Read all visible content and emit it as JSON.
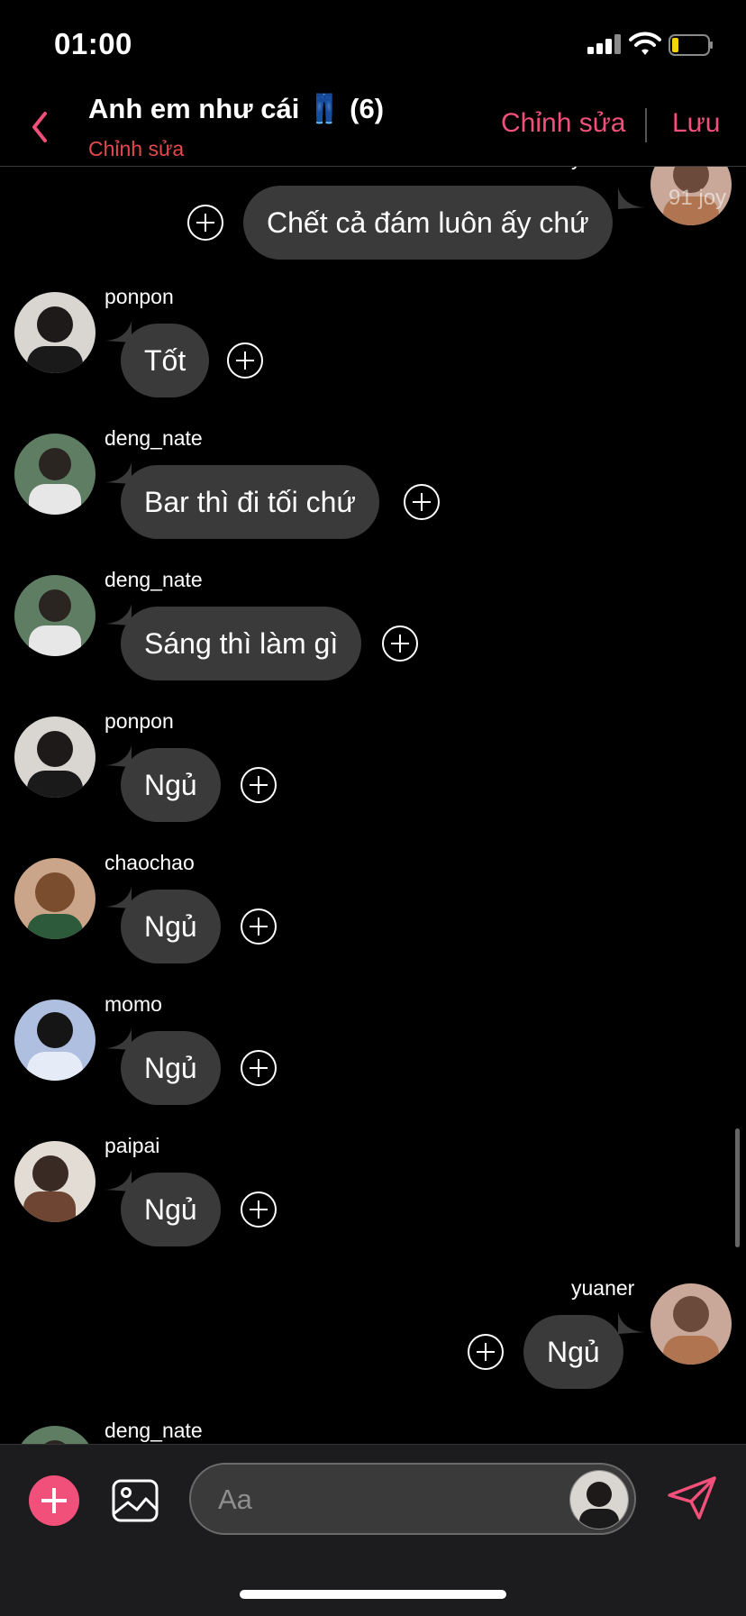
{
  "status_bar": {
    "time": "01:00"
  },
  "header": {
    "title": "Anh em như cái 👖 (6)",
    "subtitle": "Chỉnh sửa",
    "edit_label": "Chỉnh sửa",
    "save_label": "Lưu"
  },
  "messages": [
    {
      "sender": "yuaner",
      "text": "Chết cả đám luôn ấy chứ",
      "side": "right",
      "watermark": "91 joy"
    },
    {
      "sender": "ponpon",
      "text": "Tốt",
      "side": "left"
    },
    {
      "sender": "deng_nate",
      "text": "Bar thì đi tối chứ",
      "side": "left"
    },
    {
      "sender": "deng_nate",
      "text": "Sáng thì làm gì",
      "side": "left"
    },
    {
      "sender": "ponpon",
      "text": "Ngủ",
      "side": "left"
    },
    {
      "sender": "chaochao",
      "text": "Ngủ",
      "side": "left"
    },
    {
      "sender": "momo",
      "text": "Ngủ",
      "side": "left"
    },
    {
      "sender": "paipai",
      "text": "Ngủ",
      "side": "left"
    },
    {
      "sender": "yuaner",
      "text": "Ngủ",
      "side": "right"
    },
    {
      "sender": "deng_nate",
      "text": "",
      "side": "left"
    }
  ],
  "composer": {
    "placeholder": "Aa"
  },
  "colors": {
    "accent": "#f0507a",
    "subtitle": "#e5484d",
    "bubble": "#3a3a3a",
    "background": "#000000"
  }
}
